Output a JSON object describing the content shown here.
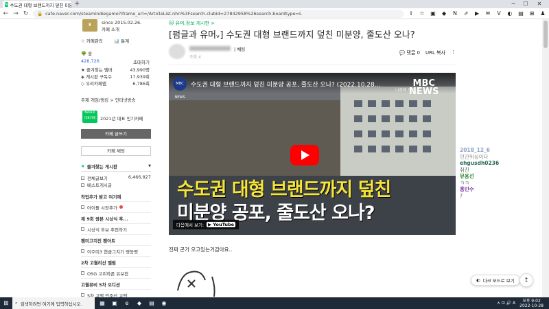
{
  "browser": {
    "tab_title": "수도권 대형 브랜드까지 덮친 미분",
    "tab_favicon": "N",
    "tab_close": "×",
    "new_tab": "+",
    "url": "cafe.naver.com/steamindiegame?iframe_url=/ArticleList.nhn%3Fsearch.clubid=27842958%26search.boardtype=L",
    "back_icon": "←",
    "forward_icon": "→",
    "reload_icon": "↻",
    "lock_icon": "🔒",
    "extensions": [
      "⇪",
      "☆",
      "▣",
      "◆",
      "N",
      "⇗",
      "▶",
      "✉",
      "V",
      "◐",
      "▤",
      "⊞",
      "♟"
    ],
    "win_min": "─",
    "win_max": "☐",
    "win_close": "✕"
  },
  "sidebar": {
    "cafe_since": "since 2015.02.26.",
    "cafe_intro": "카페 소개",
    "manage": "☆ 카페관리",
    "stats": "📊 통계",
    "level": "숲",
    "members_label": "428,726",
    "members_invite": "초대하기",
    "stats_rows": [
      {
        "label": "★ 즐겨찾는 멤버",
        "value": "43,990명"
      },
      {
        "label": "◈ 게시판 구독수",
        "value": "17,939회"
      },
      {
        "label": "◇ 우리카페앱",
        "value": "6,786회"
      }
    ],
    "theme_row": "주제  게임/랭킹 > 인터넷방송",
    "badge_top": "NAVER",
    "badge_bottom": "대표카페",
    "badge_text": "2021년 대표 인기카페",
    "write_button": "카페 글쓰기",
    "chat_button": "카페 채팅",
    "fav_header": "즐겨찾는 게시판",
    "fav_items": [
      {
        "label": "전체글보기",
        "count": "6,466,827"
      },
      {
        "label": "베스트게시글",
        "count": ""
      }
    ],
    "menu": [
      {
        "label": "작업추가 받고 여기에",
        "bold": true,
        "check": false,
        "new": false
      },
      {
        "label": "아이돌 시장추가",
        "bold": false,
        "check": true,
        "new": true
      },
      {
        "label": "제 9회 왕본 시상식 후...",
        "bold": true,
        "check": false,
        "new": false
      },
      {
        "label": "시상식 후보 추천하기",
        "bold": false,
        "check": true,
        "new": false
      },
      {
        "label": "팬미고치진 팬아트",
        "bold": true,
        "check": false,
        "new": false
      },
      {
        "label": "이주미3 현금그치기 영동평",
        "bold": false,
        "check": true,
        "new": false
      },
      {
        "label": "2차 고월리산 앨범",
        "bold": true,
        "check": false,
        "new": false
      },
      {
        "label": "OSG 고위하폰 유보찬",
        "bold": false,
        "check": true,
        "new": false
      },
      {
        "label": "고월뮤비 5차 오디션",
        "bold": true,
        "check": false,
        "new": false
      },
      {
        "label": "5차 고맥 인조선 고엔",
        "bold": false,
        "check": true,
        "new": false
      }
    ]
  },
  "article": {
    "category": "유머,정보 게시판 >",
    "title": "[펌글과 유머ᵥ] 수도권 대형 브랜드까지 덮친 미분양, 줄도산 오나?",
    "author_tag": "| 채팅",
    "date_blur": "조회 4",
    "comments": "💬 댓글 0",
    "url_copy": "URL 복사",
    "more_icon": "⋮",
    "video_title": "수도권 대형 브랜드까지 덮친 미분양 공포, 줄도산 오나? (2022.10.28...",
    "watch_later": "나중에 보기",
    "mbc_logo_top": "MBC",
    "mbc_logo_bottom": "NEWS",
    "mbc_small": "MBC NEWS",
    "caption_line1": "수도권 대형 브랜드까지 덮친",
    "caption_line2": "미분양 공포, 줄도산 오나?",
    "watch_on": "다음에서 보기:",
    "youtube": "▶ YouTube",
    "body_text": "진짜 곤거 오고있는거감아요.."
  },
  "chat": [
    {
      "text": "2018_12_6",
      "color": "#8aa0c8"
    },
    {
      "text": "인간위싱이다",
      "color": "#888"
    },
    {
      "text": "ehgusdh0236",
      "color": "#2b6a5a"
    },
    {
      "text": "취친",
      "color": "#666"
    },
    {
      "text": "뮤용선",
      "color": "#2a8a3a"
    },
    {
      "text": "ㅋㅋ",
      "color": "#666"
    },
    {
      "text": "홍민수",
      "color": "#7a3aa8"
    },
    {
      "text": "?",
      "color": "#666"
    }
  ],
  "darkmode_label": "다크 모드로 보기",
  "darkmode_icon": "◐",
  "top_button": "↥",
  "taskbar": {
    "start": "⊞",
    "search_placeholder": "검색하려면 여기에 입력하십시오.",
    "search_icon": "⌕",
    "apps": [
      "▦",
      "▣",
      "e",
      "◆",
      "▤",
      "◉"
    ],
    "time": "오후 9:02",
    "date": "2022-10-28",
    "tray": "∧ ⊡ 🔊 A"
  },
  "colors": {
    "naver_green": "#03c75a",
    "youtube_red": "#ff0000",
    "caption_yellow": "#f5e43a"
  }
}
